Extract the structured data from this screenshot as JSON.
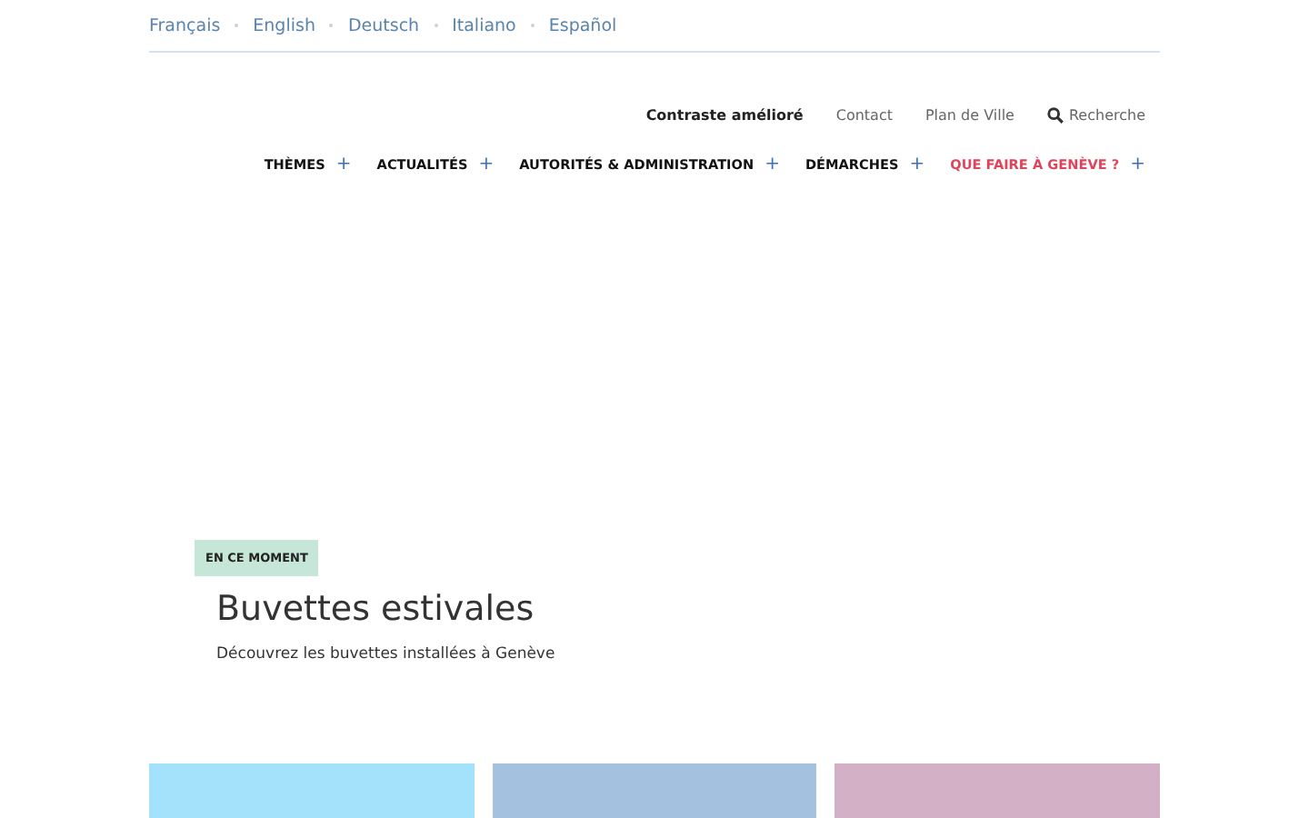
{
  "languages": [
    {
      "label": "Français"
    },
    {
      "label": "English"
    },
    {
      "label": "Deutsch"
    },
    {
      "label": "Italiano"
    },
    {
      "label": "Español"
    }
  ],
  "utility_links": [
    {
      "label": "Contraste amélioré",
      "kind": "bold"
    },
    {
      "label": "Contact",
      "kind": "plain"
    },
    {
      "label": "Plan de Ville",
      "kind": "plain"
    },
    {
      "label": "Recherche",
      "kind": "search"
    }
  ],
  "nav": [
    {
      "label": "THÈMES",
      "highlighted": false,
      "expand": "+"
    },
    {
      "label": "ACTUALITÉS",
      "highlighted": false,
      "expand": "+"
    },
    {
      "label": "AUTORITÉS & ADMINISTRATION",
      "highlighted": false,
      "expand": "+"
    },
    {
      "label": "DÉMARCHES",
      "highlighted": false,
      "expand": "+"
    },
    {
      "label": "QUE FAIRE À GENÈVE ?",
      "highlighted": true,
      "expand": "+"
    }
  ],
  "feature": {
    "badge": "EN CE MOMENT",
    "title": "Buvettes estivales",
    "subtitle": "Découvrez les buvettes installées à Genève"
  },
  "tiles": [
    {
      "color": "#a4e2fc"
    },
    {
      "color": "#a4c2e0"
    },
    {
      "color": "#d4b0c6"
    }
  ]
}
